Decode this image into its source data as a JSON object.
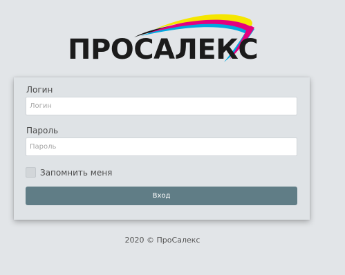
{
  "brand": {
    "logo_text": "ПРОСАЛЕКС",
    "swoosh_colors": [
      "#f5e600",
      "#00a9e0",
      "#e4007f",
      "#1b1b1b"
    ]
  },
  "form": {
    "login_label": "Логин",
    "login_placeholder": "Логин",
    "login_value": "",
    "password_label": "Пароль",
    "password_placeholder": "Пароль",
    "password_value": "",
    "remember_label": "Запомнить меня",
    "remember_checked": false,
    "submit_label": "Вход"
  },
  "colors": {
    "background": "#e2e5e8",
    "button": "#607d86"
  },
  "footer": {
    "text": "2020 © ПроСалекс"
  }
}
